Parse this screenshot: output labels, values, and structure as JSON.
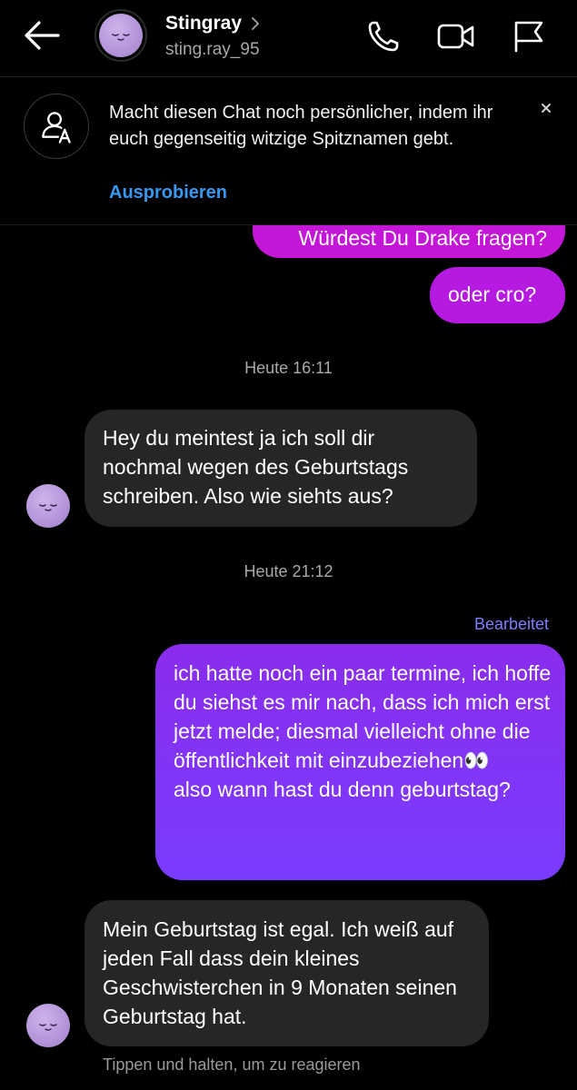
{
  "header": {
    "contact_name": "Stingray",
    "username": "sting.ray_95",
    "back_icon": "arrow-left-icon",
    "chevron_icon": "chevron-right-icon",
    "actions": [
      "phone-icon",
      "video-camera-icon",
      "flag-icon"
    ]
  },
  "banner": {
    "icon": "nickname-person-icon",
    "text": "Macht diesen Chat noch persönlicher, indem ihr euch gegenseitig witzige Spitznamen gebt.",
    "link": "Ausprobieren",
    "close_icon": "close-icon"
  },
  "messages": {
    "sent_1": "Würdest Du Drake fragen?",
    "sent_2": "oder cro?",
    "timestamp_1": "Heute 16:11",
    "received_1": "Hey du meintest ja ich soll dir nochmal wegen des Geburtstags schreiben. Also wie siehts aus?",
    "timestamp_2": "Heute 21:12",
    "edited_label": "Bearbeitet",
    "sent_3": "ich hatte noch ein paar termine, ich hoffe du siehst es mir nach, dass ich mich erst jetzt melde; diesmal vielleicht ohne die öffentlichkeit mit einzubeziehen👀\nalso wann hast du denn geburtstag?",
    "received_2": "Mein Geburtstag ist egal. Ich weiß auf jeden Fall dass dein kleines Geschwisterchen in 9 Monaten seinen Geburtstag hat."
  },
  "hint": "Tippen und halten, um zu reagieren",
  "colors": {
    "background": "#000000",
    "received_bubble": "#262626",
    "sent_bubble_magenta": "#c316d6",
    "sent_bubble_purple": "#7a3cff",
    "link_blue": "#3897f0",
    "edited_label": "#7f7dff"
  }
}
